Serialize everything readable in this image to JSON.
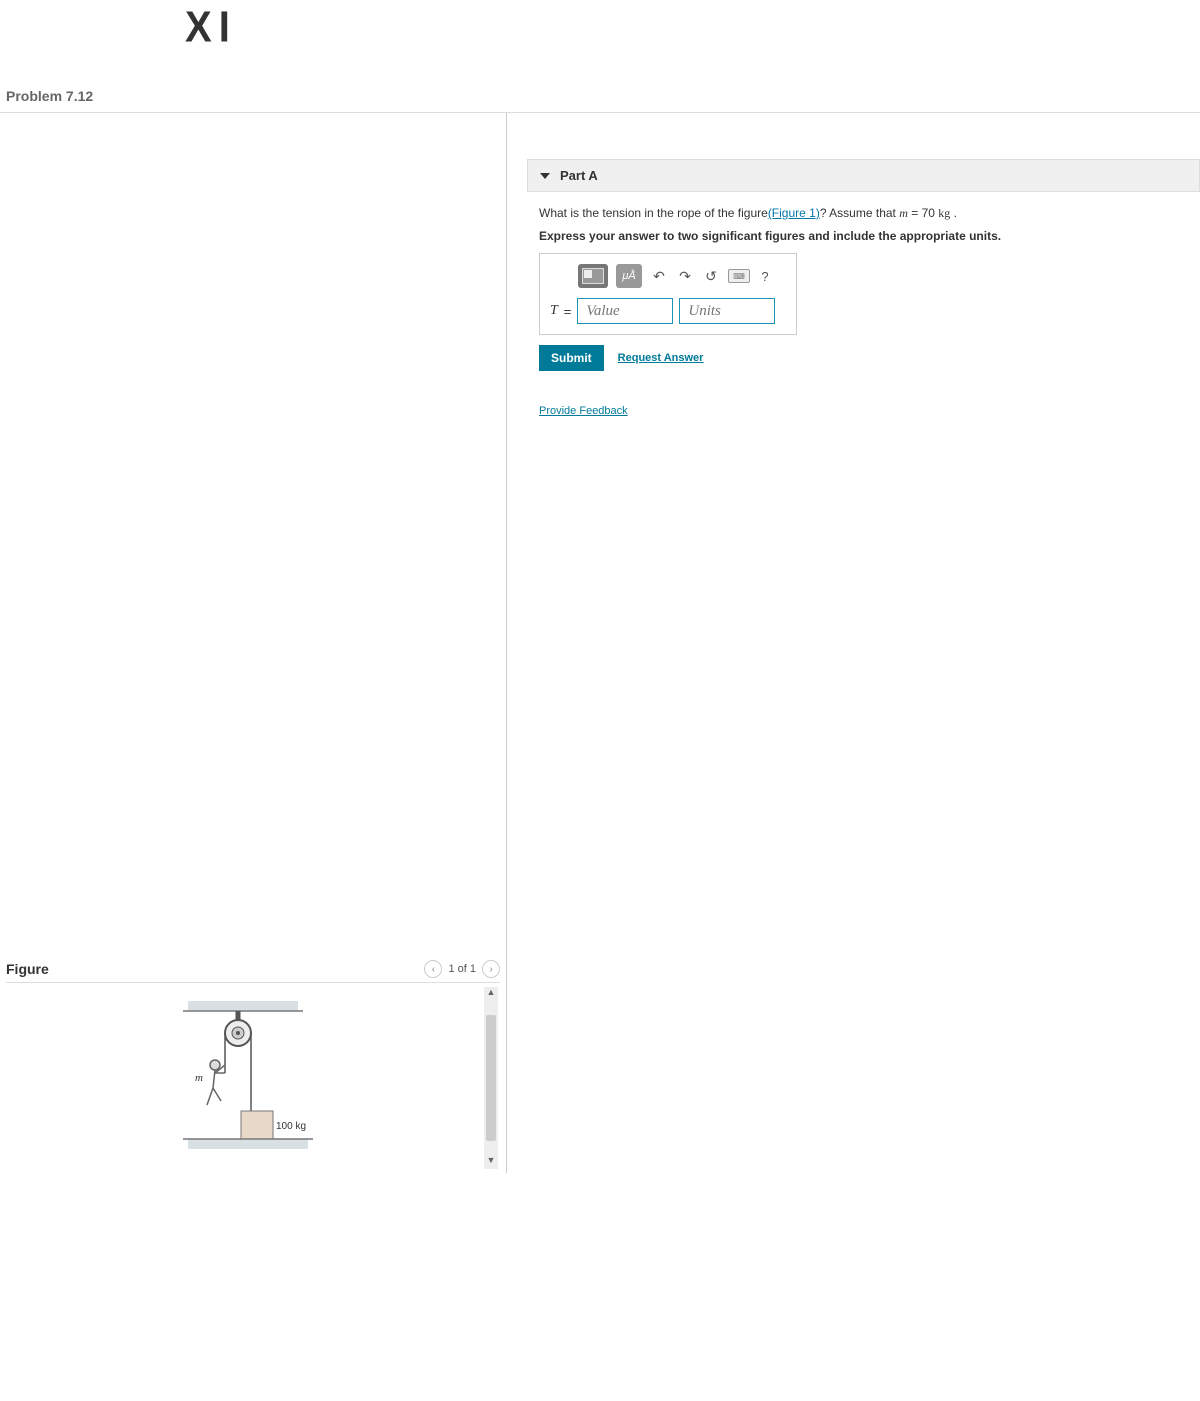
{
  "annotation": {
    "top_mark": "X I"
  },
  "problem": {
    "title": "Problem 7.12"
  },
  "figure_panel": {
    "title": "Figure",
    "page_text": "1 of 1",
    "labels": {
      "m": "m",
      "box_mass": "100 kg"
    }
  },
  "part": {
    "header": "Part A",
    "question_prefix": "What is the tension in the rope of the figure",
    "figure_link": "(Figure 1)",
    "question_mid": "? Assume that ",
    "mass_var": "m",
    "mass_eq": " = 70 ",
    "mass_unit": "kg",
    "question_end": " .",
    "instruction": "Express your answer to two significant figures and include the appropriate units.",
    "toolbar": {
      "special_chars": "μÅ",
      "help": "?"
    },
    "answer": {
      "var": "T",
      "eq": "=",
      "value_placeholder": "Value",
      "units_placeholder": "Units"
    },
    "submit_label": "Submit",
    "request_label": "Request Answer"
  },
  "feedback": {
    "label": "Provide Feedback"
  }
}
